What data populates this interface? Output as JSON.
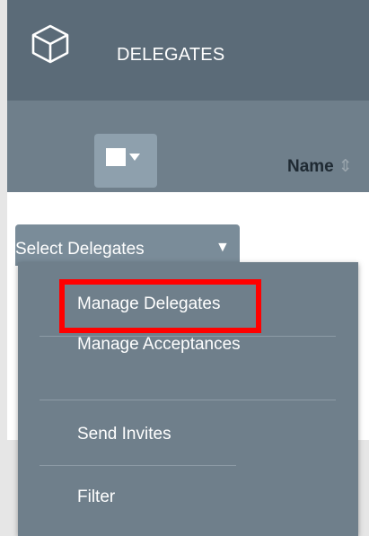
{
  "header": {
    "module_icon": "cube-icon",
    "title": "DELEGATES"
  },
  "table_header": {
    "bulk_icon": "checkbox-dropdown-icon",
    "name_column": "Name",
    "sort_icon": "sort-icon",
    "sort_glyph": "⇕"
  },
  "select_tab": {
    "label": "Select Delegates",
    "caret": "▼"
  },
  "peek": {
    "text": "d"
  },
  "menu": {
    "items": [
      {
        "label": "Manage Delegates",
        "highlighted": true
      },
      {
        "label": "Manage Acceptances",
        "highlighted": false
      },
      {
        "label": "Send Invites",
        "highlighted": false
      },
      {
        "label": "Filter",
        "highlighted": false
      }
    ]
  },
  "colors": {
    "header_bg": "#5b6b78",
    "menu_bg": "#6f7f8b",
    "highlight": "#ff0000"
  }
}
